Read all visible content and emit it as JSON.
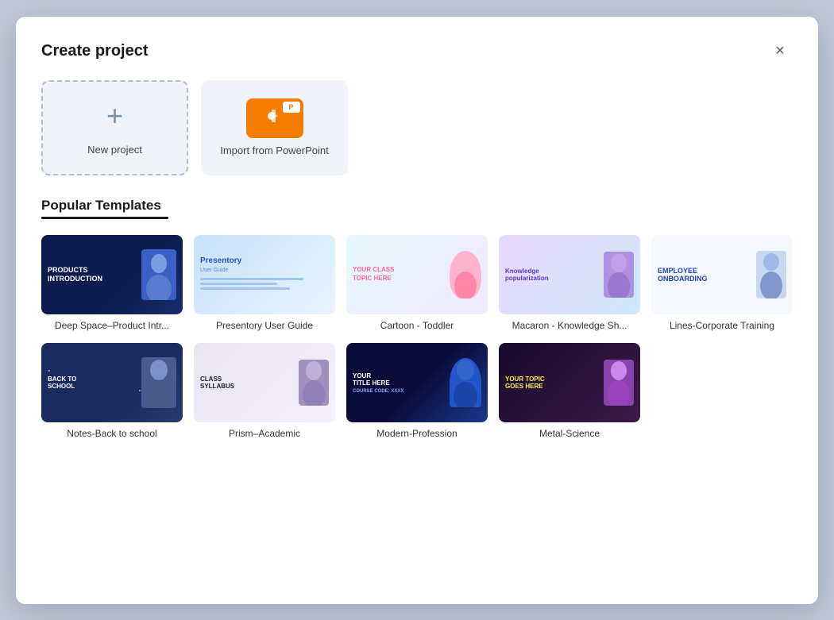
{
  "dialog": {
    "title": "Create project",
    "close_label": "×"
  },
  "top_actions": {
    "new_project_label": "New project",
    "import_label": "Import from PowerPoint"
  },
  "section": {
    "title": "Popular Templates",
    "underline": true
  },
  "templates_row1": [
    {
      "id": "deep-space",
      "label": "Deep Space–Product Intr...",
      "thumb_type": "deep-space",
      "text": "PRODUCTS INTRODUCTION"
    },
    {
      "id": "presentory",
      "label": "Presentory User Guide",
      "thumb_type": "presentory",
      "text": "Presentory User Guide"
    },
    {
      "id": "cartoon",
      "label": "Cartoon - Toddler",
      "thumb_type": "cartoon",
      "text": "YOUR CLASS TOPIC HERE"
    },
    {
      "id": "macaron",
      "label": "Macaron - Knowledge Sh...",
      "thumb_type": "macaron",
      "text": "Knowledge popularization"
    },
    {
      "id": "lines",
      "label": "Lines-Corporate Training",
      "thumb_type": "lines",
      "text": "EMPLOYEE ONBOARDING"
    }
  ],
  "templates_row2": [
    {
      "id": "notes",
      "label": "Notes-Back to school",
      "thumb_type": "notes",
      "text": "BACK TO SCHOOL"
    },
    {
      "id": "prism",
      "label": "Prism–Academic",
      "thumb_type": "prism",
      "text": "CLASS SYLLABUS"
    },
    {
      "id": "modern",
      "label": "Modern-Profession",
      "thumb_type": "modern",
      "text": "YOUR TITLE HERE"
    },
    {
      "id": "metal",
      "label": "Metal-Science",
      "thumb_type": "metal",
      "text": "YOUR TOPIC GOES HERE"
    }
  ]
}
